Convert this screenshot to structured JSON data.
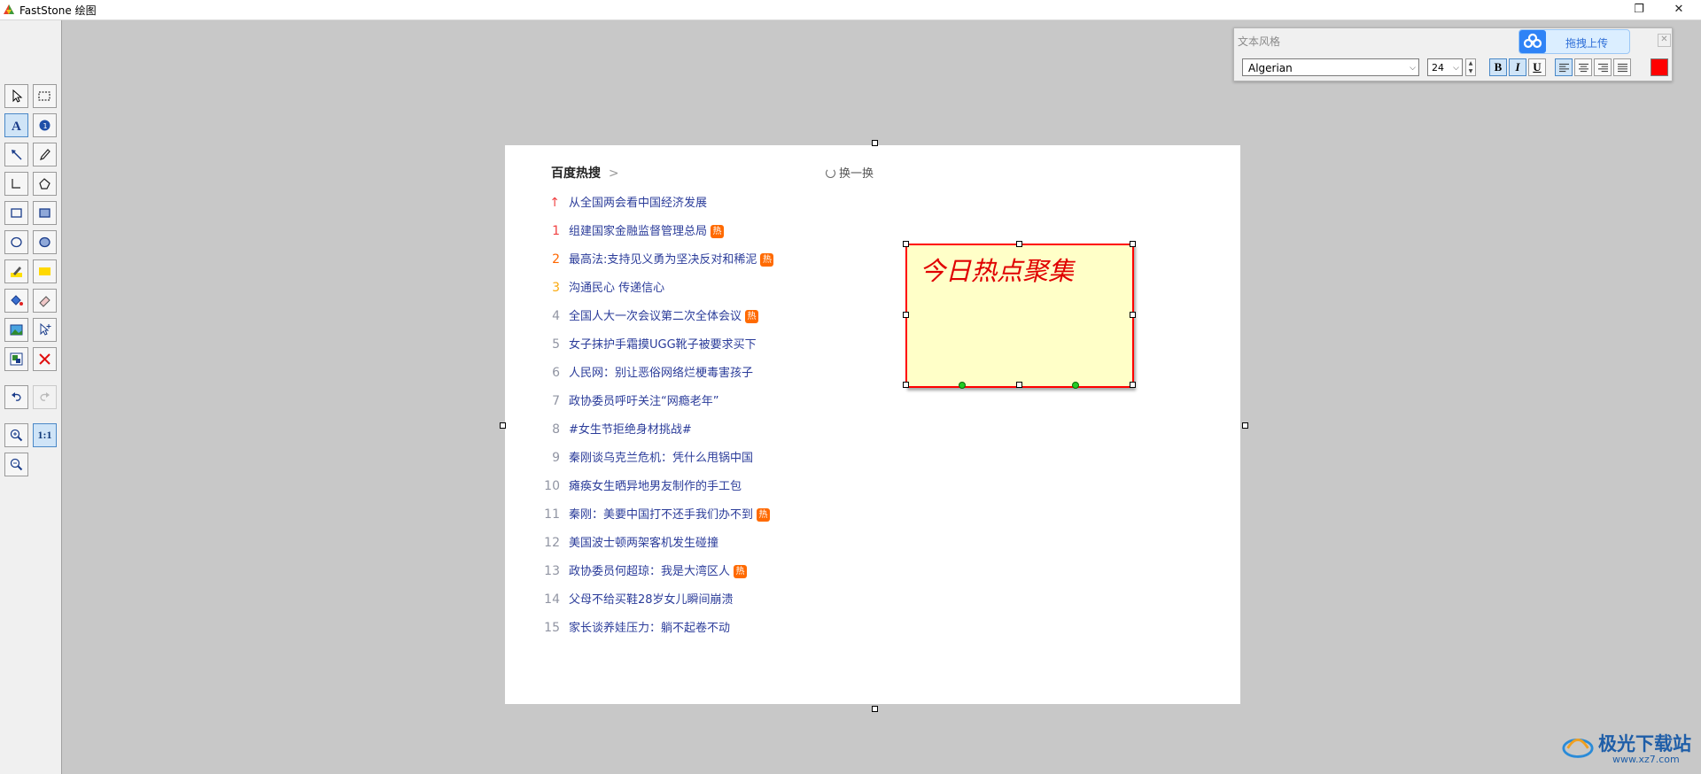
{
  "window": {
    "title": "FastStone 绘图",
    "restore_glyph": "❐",
    "close_glyph": "✕"
  },
  "tools": {
    "zoom_actual_label": "1:1",
    "icons": [
      "pointer-icon",
      "rect-select-icon",
      "text-icon",
      "numbered-marker-icon",
      "arrow-icon",
      "pencil-icon",
      "line-icon",
      "polygon-icon",
      "rectangle-icon",
      "filled-rectangle-icon",
      "ellipse-icon",
      "filled-ellipse-icon",
      "highlighter-icon",
      "filled-highlight-icon",
      "fill-bucket-icon",
      "eraser-icon",
      "insert-image-icon",
      "cursor-stamp-icon",
      "watermark-icon",
      "delete-icon",
      "undo-icon",
      "redo-icon",
      "zoom-in-icon",
      "zoom-out-icon"
    ]
  },
  "page": {
    "hot_search": {
      "title": "百度热搜",
      "title_chevron": ">",
      "refresh_label": "换一换",
      "hot_badge": "热",
      "items": [
        {
          "rank": "↑",
          "text": "从全国两会看中国经济发展",
          "hot": false,
          "rank_color": "#f04142"
        },
        {
          "rank": "1",
          "text": "组建国家金融监督管理总局",
          "hot": true,
          "rank_color": "#f04142"
        },
        {
          "rank": "2",
          "text": "最高法:支持见义勇为坚决反对和稀泥",
          "hot": true,
          "rank_color": "#ff6600"
        },
        {
          "rank": "3",
          "text": "沟通民心 传递信心",
          "hot": false,
          "rank_color": "#faa90e"
        },
        {
          "rank": "4",
          "text": "全国人大一次会议第二次全体会议",
          "hot": true,
          "rank_color": "#9195a3"
        },
        {
          "rank": "5",
          "text": "女子抹护手霜摸UGG靴子被要求买下",
          "hot": false,
          "rank_color": "#9195a3"
        },
        {
          "rank": "6",
          "text": "人民网：别让恶俗网络烂梗毒害孩子",
          "hot": false,
          "rank_color": "#9195a3"
        },
        {
          "rank": "7",
          "text": "政协委员呼吁关注“网瘾老年”",
          "hot": false,
          "rank_color": "#9195a3"
        },
        {
          "rank": "8",
          "text": "#女生节拒绝身材挑战#",
          "hot": false,
          "rank_color": "#9195a3"
        },
        {
          "rank": "9",
          "text": "秦刚谈乌克兰危机：凭什么甩锅中国",
          "hot": false,
          "rank_color": "#9195a3"
        },
        {
          "rank": "10",
          "text": "瘫痪女生晒异地男友制作的手工包",
          "hot": false,
          "rank_color": "#9195a3"
        },
        {
          "rank": "11",
          "text": "秦刚：美要中国打不还手我们办不到",
          "hot": true,
          "rank_color": "#9195a3"
        },
        {
          "rank": "12",
          "text": "美国波士顿两架客机发生碰撞",
          "hot": false,
          "rank_color": "#9195a3"
        },
        {
          "rank": "13",
          "text": "政协委员何超琼：我是大湾区人",
          "hot": true,
          "rank_color": "#9195a3"
        },
        {
          "rank": "14",
          "text": "父母不给买鞋28岁女儿瞬间崩溃",
          "hot": false,
          "rank_color": "#9195a3"
        },
        {
          "rank": "15",
          "text": "家长谈养娃压力：躺不起卷不动",
          "hot": false,
          "rank_color": "#9195a3"
        }
      ]
    },
    "textbox": {
      "text": "今日热点聚集",
      "text_color": "#e00000",
      "fill_color": "#ffffc8",
      "border_color": "#ff0000"
    }
  },
  "text_style_panel": {
    "caption": "文本风格",
    "font": "Algerian",
    "size": "24",
    "bold_label": "B",
    "italic_label": "I",
    "underline_label": "U",
    "align_icons": [
      "align-left-icon",
      "align-center-icon",
      "align-right-icon",
      "align-justify-icon"
    ],
    "color": "#ff0000",
    "close_glyph": "✕"
  },
  "upload_widget": {
    "label": "拖拽上传"
  },
  "watermark": {
    "text": "极光下载站",
    "url": "www.xz7.com"
  }
}
